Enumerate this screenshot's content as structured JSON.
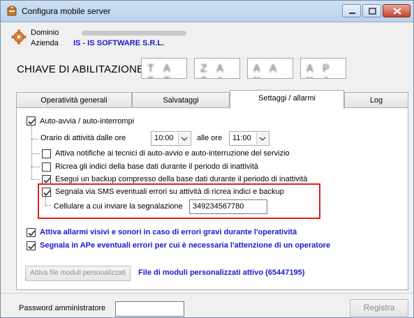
{
  "window": {
    "title": "Configura mobile server"
  },
  "header": {
    "dominio_label": "Dominio",
    "azienda_label": "Azienda",
    "azienda_value": "IS - IS SOFTWARE S.R.L."
  },
  "license": {
    "label": "CHIAVE DI ABILITAZIONE",
    "key_parts": [
      "T A T T",
      "Z A I A",
      "A A M",
      "A P M A"
    ]
  },
  "tabs": [
    "Operatività generali",
    "Salvataggi",
    "Settaggi / allarmi",
    "Log"
  ],
  "active_tab": "Settaggi / allarmi",
  "settings": {
    "auto_start": {
      "label": "Auto-avvia / auto-interrompi",
      "checked": true
    },
    "schedule": {
      "from_label": "Orario  di  attività  dalle  ore",
      "from_value": "10:00",
      "to_label": "alle ore",
      "to_value": "11:00"
    },
    "notify_tech": {
      "label": "Attiva notifiche ai tecnici di auto-avvio e auto-interruzione del servizio",
      "checked": false
    },
    "reindex": {
      "label": "Ricrea gli indici della base dati durante il periodo di inattività",
      "checked": false
    },
    "backup": {
      "label": "Esegui un backup compresso della base dati durante il periodo di inattività",
      "checked": true
    },
    "sms_alert": {
      "label": "Segnala via SMS eventuali errori su attività di ricrea indici e backup",
      "checked": true
    },
    "phone": {
      "label": "Cellulare a cui inviare la segnalazione",
      "value": "349234567780"
    },
    "visual_alarms": {
      "label": "Attiva allarmi visivi e sonori in caso di errori gravi durante l'operatività",
      "checked": true
    },
    "ape_alert": {
      "label": "Segnala in APe eventuali errori per cui è necessaria l'attenzione di un operatore",
      "checked": true
    },
    "custom_modules_button": "Attiva file moduli personalizzati",
    "custom_modules_status": "File di moduli personalizzati attivo (65447195)"
  },
  "footer": {
    "password_label": "Password amministratore",
    "password_value": "",
    "save_button": "Registra"
  },
  "colors": {
    "accent_blue": "#1a1acc",
    "highlight_red": "#e02020"
  }
}
